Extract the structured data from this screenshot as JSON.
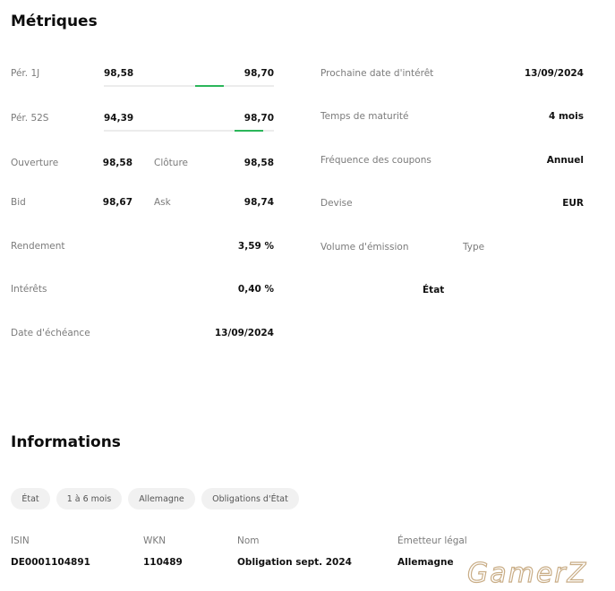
{
  "metrics": {
    "title": "Métriques",
    "range_1d": {
      "label": "Pér. 1J",
      "low": "98,58",
      "high": "98,70",
      "position": 0.62
    },
    "range_52w": {
      "label": "Pér. 52S",
      "low": "94,39",
      "high": "98,70",
      "position": 0.85
    },
    "open": {
      "label": "Ouverture",
      "value": "98,58"
    },
    "close": {
      "label": "Clôture",
      "value": "98,58"
    },
    "bid": {
      "label": "Bid",
      "value": "98,67"
    },
    "ask": {
      "label": "Ask",
      "value": "98,74"
    },
    "yield": {
      "label": "Rendement",
      "value": "3,59 %"
    },
    "interest": {
      "label": "Intérêts",
      "value": "0,40 %"
    },
    "maturity_date": {
      "label": "Date d'échéance",
      "value": "13/09/2024"
    },
    "next_interest_date": {
      "label": "Prochaine date d'intérêt",
      "value": "13/09/2024"
    },
    "time_to_maturity": {
      "label": "Temps de maturité",
      "value": "4 mois"
    },
    "coupon_frequency": {
      "label": "Fréquence des coupons",
      "value": "Annuel"
    },
    "currency": {
      "label": "Devise",
      "value": "EUR"
    },
    "issue_volume": {
      "label": "Volume d'émission"
    },
    "type": {
      "label": "Type",
      "value": "État"
    }
  },
  "info": {
    "title": "Informations",
    "tags": [
      "État",
      "1 à 6 mois",
      "Allemagne",
      "Obligations d'État"
    ],
    "isin": {
      "label": "ISIN",
      "value": "DE0001104891"
    },
    "wkn": {
      "label": "WKN",
      "value": "110489"
    },
    "name": {
      "label": "Nom",
      "value": "Obligation sept. 2024"
    },
    "issuer": {
      "label": "Émetteur légal",
      "value": "Allemagne"
    }
  },
  "watermark": {
    "text": "GamerZ"
  },
  "colors": {
    "accent": "#2bb65a",
    "chip_bg": "#f1f1f1",
    "label": "#7b7b7b"
  }
}
